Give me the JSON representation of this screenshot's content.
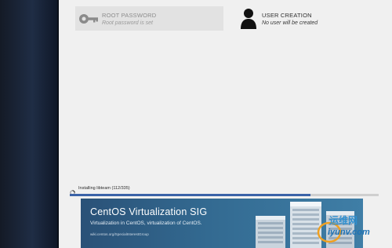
{
  "spokes": {
    "root_password": {
      "title": "ROOT PASSWORD",
      "status": "Root password is set",
      "icon": "key-icon"
    },
    "user_creation": {
      "title": "USER CREATION",
      "status": "No user will be created",
      "icon": "user-icon"
    }
  },
  "progress": {
    "text": "Installing libteam (112/335)",
    "fraction": 0.78,
    "color": "#3b63a8"
  },
  "banner": {
    "title": "CentOS Virtualization SIG",
    "subtitle": "Virtualization in CentOS, virtualization of CentOS.",
    "url": "wiki.centos.org/SpecialInterestGroup"
  },
  "watermark": {
    "text_cn": "运维网",
    "url": "iyunv.com"
  },
  "colors": {
    "sidebar": "#1f2d45",
    "accent": "#3b63a8",
    "banner": "#336a91"
  }
}
